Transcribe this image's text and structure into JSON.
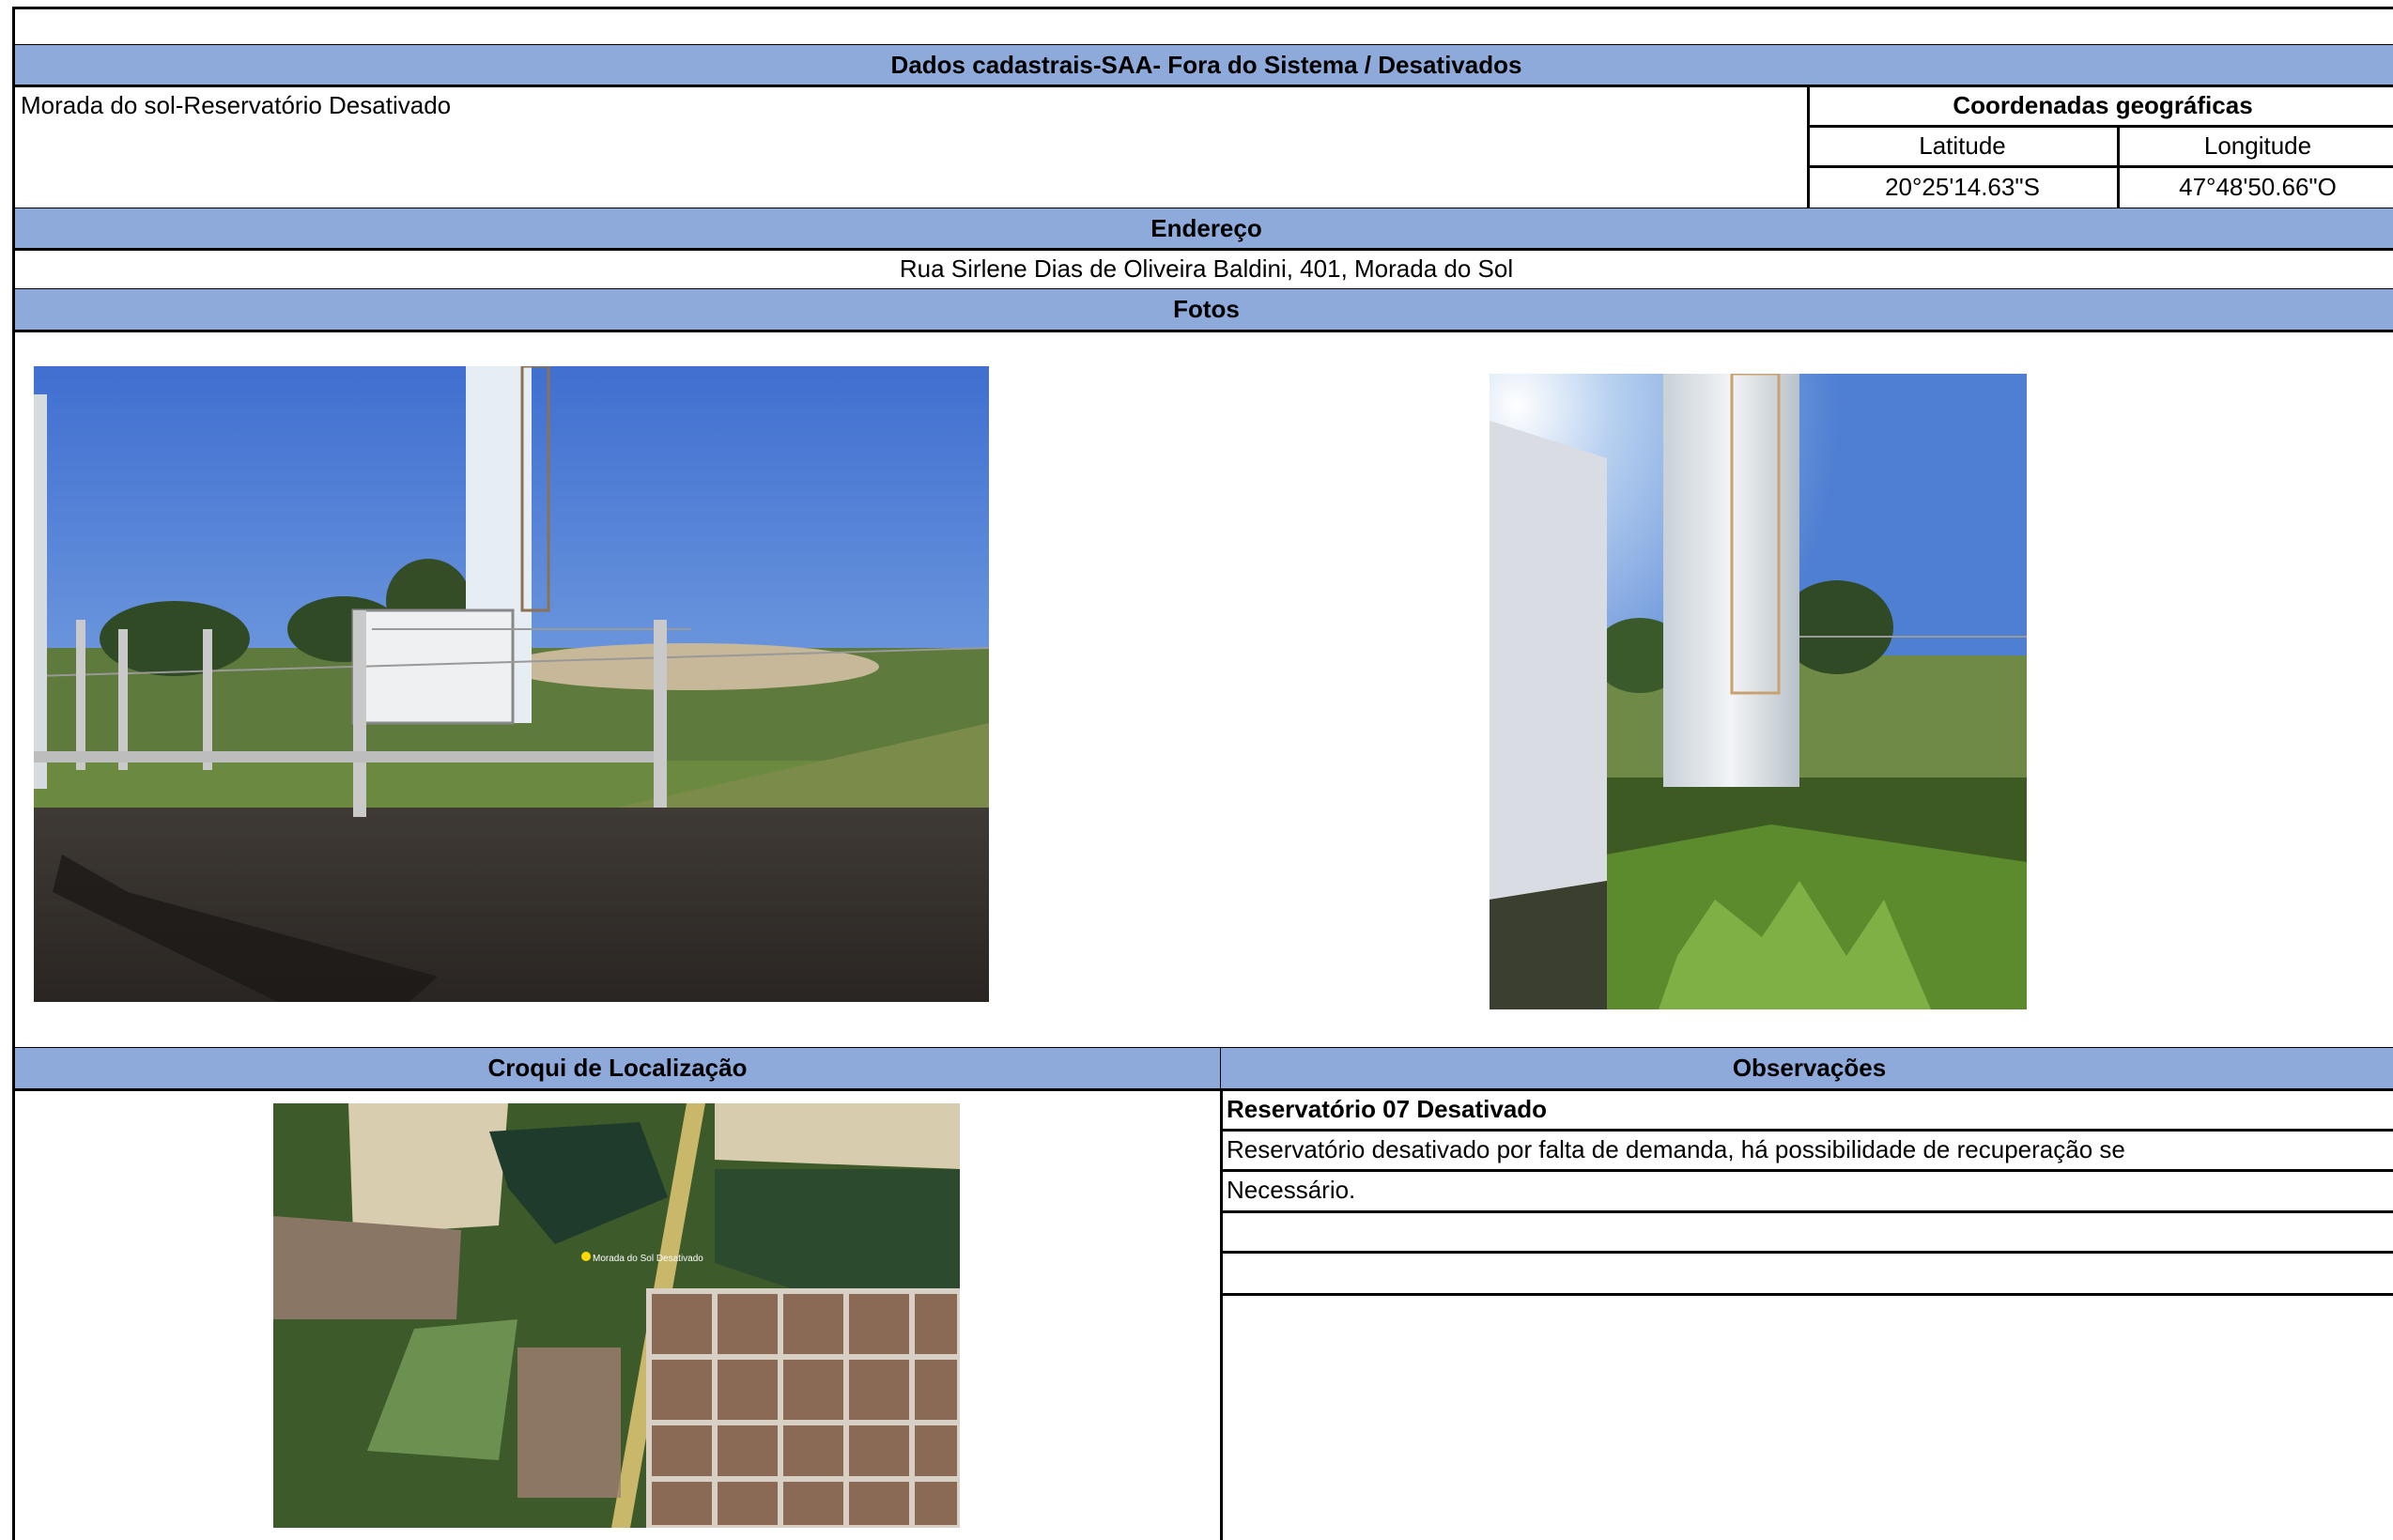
{
  "header": {
    "title": "Dados cadastrais-SAA- Fora do Sistema / Desativados"
  },
  "site": {
    "name": "Morada do sol-Reservatório Desativado"
  },
  "coordinates": {
    "title": "Coordenadas geográficas",
    "latitude_label": "Latitude",
    "longitude_label": "Longitude",
    "latitude": "20°25'14.63\"S",
    "longitude": "47°48'50.66\"O"
  },
  "address": {
    "title": "Endereço",
    "value": "Rua Sirlene Dias de Oliveira Baldini, 401, Morada do Sol"
  },
  "photos": {
    "title": "Fotos"
  },
  "location_sketch": {
    "title": "Croqui de Localização",
    "map_label": "Morada do Sol Desativado"
  },
  "observations": {
    "title": "Observações",
    "lines": [
      "Reservatório 07 Desativado",
      "Reservatório desativado por falta de demanda, há possibilidade de recuperação se",
      "Necessário.",
      "",
      ""
    ]
  },
  "colors": {
    "header_fill": "#8eaadb",
    "border": "#000000"
  }
}
